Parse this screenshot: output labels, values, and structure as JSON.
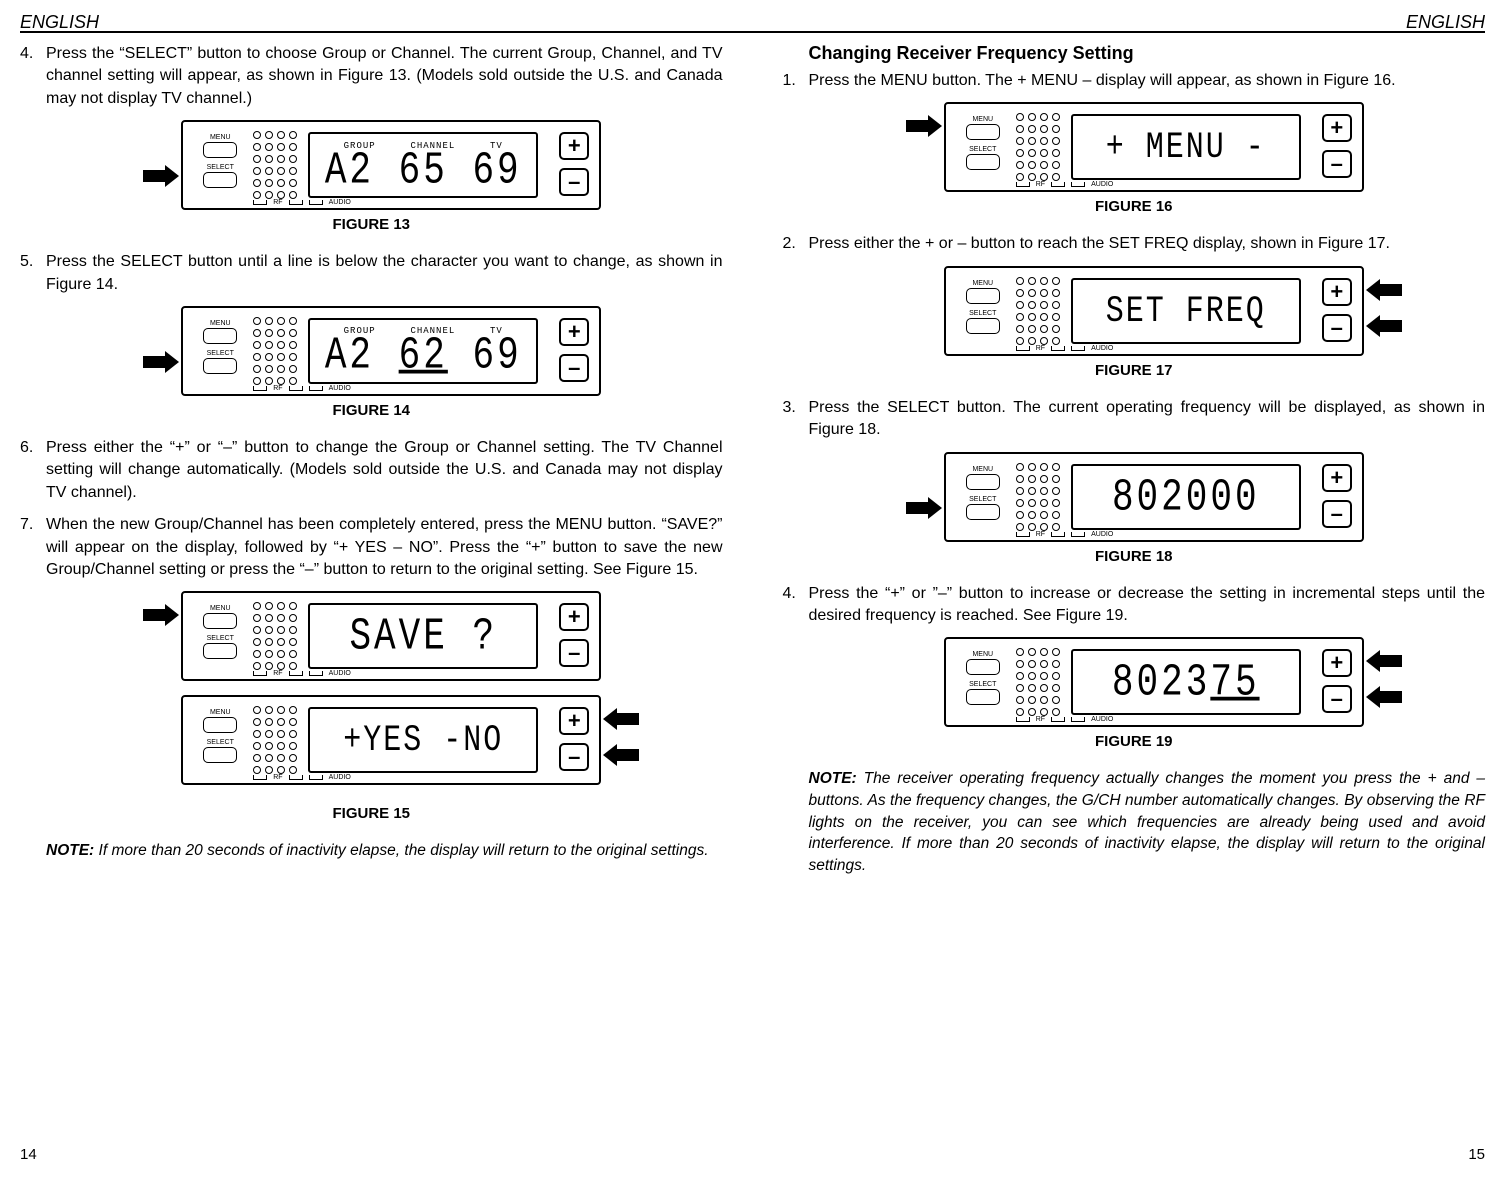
{
  "header": {
    "left": "ENGLISH",
    "right": "ENGLISH"
  },
  "left": {
    "item4": {
      "num": "4.",
      "text": "Press the “SELECT” button to choose Group or Channel. The current Group, Channel, and TV channel setting will appear, as shown in Figure 13. (Models sold outside the U.S. and Canada may not display TV channel.)"
    },
    "fig13": {
      "caption": "FIGURE 13",
      "labels": {
        "group": "GROUP",
        "channel": "CHANNEL",
        "tv": "TV"
      },
      "display": "A2 65 69"
    },
    "item5": {
      "num": "5.",
      "text": "Press the SELECT button until a line is below the character you want to change, as shown in Figure 14."
    },
    "fig14": {
      "caption": "FIGURE 14",
      "labels": {
        "group": "GROUP",
        "channel": "CHANNEL",
        "tv": "TV"
      },
      "display_a": "A2 ",
      "display_u": "62",
      "display_b": " 69"
    },
    "item6": {
      "num": "6.",
      "text": "Press either the  “+” or “–” button to change the Group or Channel setting. The TV Channel setting will change automatically. (Models sold outside the U.S. and Canada may not display TV channel)."
    },
    "item7": {
      "num": "7.",
      "text": "When the new Group/Channel has been completely entered, press the MENU button. “SAVE?” will appear on the display, followed by “+ YES – NO”. Press the “+” button to save the new Group/Channel setting or press the “–” button to return to the original setting. See Figure 15."
    },
    "fig15": {
      "caption": "FIGURE 15",
      "display1": "SAVE ?",
      "display2": "+YES -NO"
    },
    "note": {
      "lead": "NOTE:",
      "text": " If more than 20 seconds of inactivity elapse, the display will return to the original settings."
    }
  },
  "right": {
    "title": "Changing Receiver Frequency Setting",
    "item1": {
      "num": "1.",
      "text": "Press the MENU button. The + MENU – display will appear, as shown in Figure 16."
    },
    "fig16": {
      "caption": "FIGURE 16",
      "display": "+ MENU -"
    },
    "item2": {
      "num": "2.",
      "text": "Press either the + or – button to reach the SET FREQ display, shown in Figure 17."
    },
    "fig17": {
      "caption": "FIGURE 17",
      "display": "SET FREQ"
    },
    "item3": {
      "num": "3.",
      "text": "Press the SELECT button. The current operating frequency will be displayed, as shown in Figure 18."
    },
    "fig18": {
      "caption": "FIGURE 18",
      "display": "802000"
    },
    "item4": {
      "num": "4.",
      "text": "Press the “+” or ”–” button to increase or decrease the setting in incremental  steps until the desired frequency is reached. See Figure 19."
    },
    "fig19": {
      "caption": "FIGURE 19",
      "display_a": "8023",
      "display_u": "75"
    },
    "note": {
      "lead": "NOTE:",
      "text": " The receiver operating frequency actually changes the moment you press the + and – buttons. As the frequency changes, the G/CH number automatically changes. By observing the RF lights on the receiver, you can see which frequencies are already being used and avoid interference. If more than 20 seconds of inactivity elapse, the display will return to the original settings."
    }
  },
  "device": {
    "menu_label": "MENU",
    "select_label": "SELECT",
    "rf_label": "RF",
    "audio_label": "AUDIO",
    "plus": "+",
    "minus": "–"
  },
  "footer": {
    "left": "14",
    "right": "15"
  }
}
